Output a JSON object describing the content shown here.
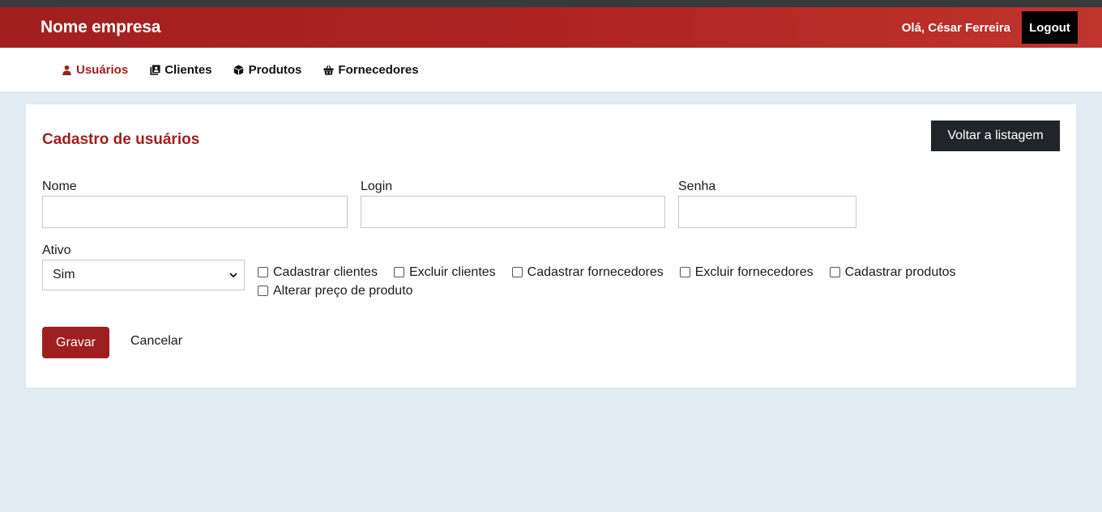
{
  "header": {
    "brand": "Nome empresa",
    "greeting": "Olá, César Ferreira",
    "logout_label": "Logout"
  },
  "nav": {
    "items": [
      {
        "label": "Usuários",
        "icon": "user-icon",
        "active": true
      },
      {
        "label": "Clientes",
        "icon": "address-book-icon",
        "active": false
      },
      {
        "label": "Produtos",
        "icon": "box-icon",
        "active": false
      },
      {
        "label": "Fornecedores",
        "icon": "basket-icon",
        "active": false
      }
    ]
  },
  "form": {
    "title": "Cadastro de usuários",
    "back_label": "Voltar a listagem",
    "nome": {
      "label": "Nome",
      "value": ""
    },
    "login": {
      "label": "Login",
      "value": ""
    },
    "senha": {
      "label": "Senha",
      "value": ""
    },
    "ativo": {
      "label": "Ativo",
      "selected": "Sim"
    },
    "permissions": [
      {
        "label": "Cadastrar clientes",
        "checked": false
      },
      {
        "label": "Excluir clientes",
        "checked": false
      },
      {
        "label": "Cadastrar fornecedores",
        "checked": false
      },
      {
        "label": "Excluir fornecedores",
        "checked": false
      },
      {
        "label": "Cadastrar produtos",
        "checked": false
      },
      {
        "label": "Alterar preço de produto",
        "checked": false
      }
    ],
    "save_label": "Gravar",
    "cancel_label": "Cancelar"
  },
  "colors": {
    "brand_red": "#9e1f1f",
    "dark_button": "#212529",
    "page_background": "#e1ebf1"
  }
}
